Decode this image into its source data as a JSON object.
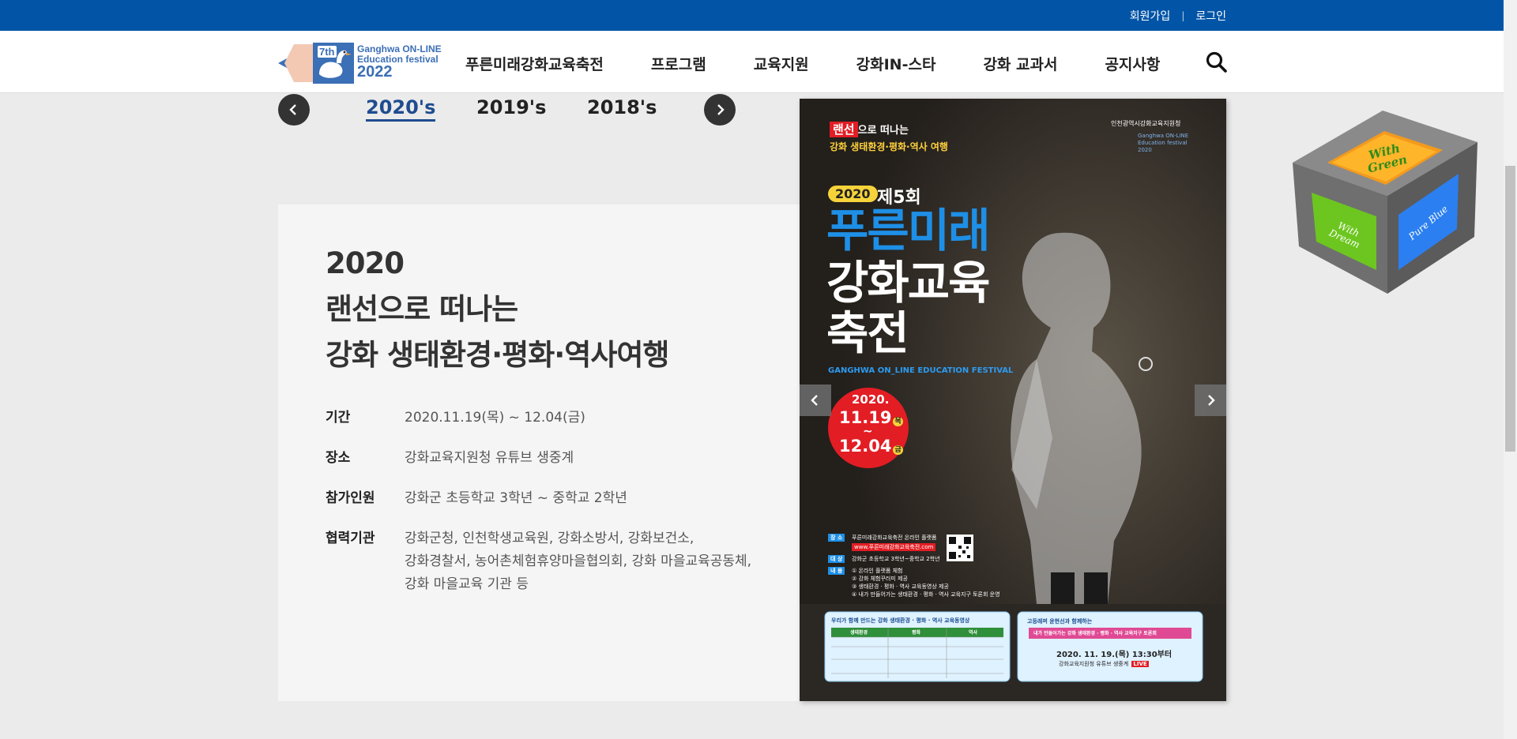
{
  "topbar": {
    "signup": "회원가입",
    "separator": "|",
    "login": "로그인"
  },
  "logo": {
    "line1": "Ganghwa ON-LINE",
    "line2": "Education festival",
    "year": "2022",
    "edition": "7th"
  },
  "nav": {
    "items": [
      "푸른미래강화교육축전",
      "프로그램",
      "교육지원",
      "강화IN-스타",
      "강화 교과서",
      "공지사항"
    ]
  },
  "years": {
    "items": [
      "2020's",
      "2019's",
      "2018's"
    ],
    "active": "2020's"
  },
  "festival": {
    "title_lines": [
      "2020",
      "랜선으로 떠나는",
      "강화 생태환경·평화·역사여행"
    ],
    "info": [
      {
        "label": "기간",
        "value": "2020.11.19(목) ~ 12.04(금)"
      },
      {
        "label": "장소",
        "value": "강화교육지원청 유튜브 생중계"
      },
      {
        "label": "참가인원",
        "value": "강화군 초등학교 3학년 ~ 중학교 2학년"
      },
      {
        "label": "협력기관",
        "value_lines": [
          "강화군청, 인천학생교육원, 강화소방서, 강화보건소,",
          "강화경찰서, 농어촌체험휴양마을협의회, 강화 마을교육공동체,",
          "강화 마을교육 기관 등"
        ]
      }
    ]
  },
  "poster": {
    "badge": "랜선",
    "badge_rest": "으로 떠나는",
    "subtitle": "강화 생태환경·평화·역사 여행",
    "org": "인천광역시강화교육지원청",
    "logo_small": "Ganghwa ON-LINE Education festival 2020",
    "year_pill": "2020",
    "edition": "제5회",
    "big1": "푸른미래",
    "big2": "강화교육",
    "big3": "축전",
    "english": "GANGHWA ON_LINE EDUCATION FESTIVAL",
    "date_year": "2020.",
    "date_start": "11.19",
    "date_start_day": "목",
    "date_tilde": "~",
    "date_end": "12.04",
    "date_end_day": "금",
    "place_tag": "장 소",
    "place_text": "푸른미래강화교육축전 온라인 플랫폼",
    "place_url": "www.푸른미래강화교육축전.com",
    "target_tag": "대 상",
    "target_text": "강화군 초등학교 3학년~중학교 2학년",
    "content_tag": "내 용",
    "contents": [
      "① 온라인 플랫폼 체험",
      "② 강화 체험꾸러미 제공",
      "③ 생태환경 · 평화 · 역사 교육동영상 제공",
      "④ 내가 만들어가는 생태환경 · 평화 · 역사 교육지구 토론회 운영"
    ],
    "box1_title": "우리가 함께 만드는 강화 생태환경 · 평화 · 역사 교육동영상",
    "box1_headers": [
      "생태환경",
      "평화",
      "역사"
    ],
    "box2_title": "고등래퍼 윤현선과 함께하는",
    "box2_banner": "내가 만들어가는 강화 생태환경 · 평화 · 역사 교육지구 토론회",
    "box2_date": "2020. 11. 19.(목) 13:30부터",
    "box2_place": "강화교육지원청 유튜브 생중계",
    "box2_live": "LIVE"
  },
  "cube": {
    "top": "With Green",
    "left": "With Dream",
    "right": "Pure Blue"
  },
  "colors": {
    "topbar": "#0255a6",
    "accent": "#1f4c8f",
    "poster_blue": "#1e8fe6",
    "poster_red": "#e31d24",
    "poster_yellow": "#f6d33a"
  }
}
